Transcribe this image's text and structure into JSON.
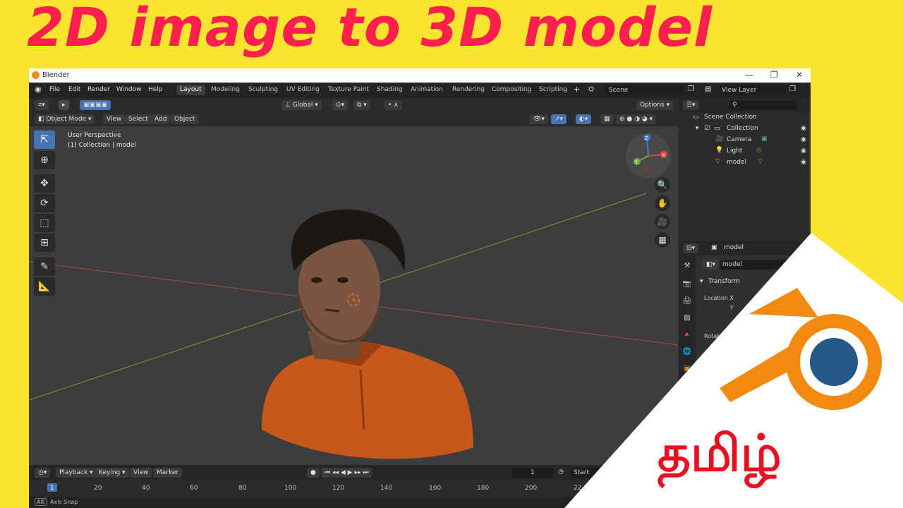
{
  "thumbnail": {
    "headline": "2D image to 3D model",
    "language_label": "தமிழ்",
    "accent": "#ff1f4f",
    "background": "#f9e52f"
  },
  "window": {
    "title": "Blender",
    "controls": [
      "—",
      "❐",
      "✕"
    ]
  },
  "menu": {
    "items": [
      "File",
      "Edit",
      "Render",
      "Window",
      "Help"
    ],
    "workspaces": [
      "Layout",
      "Modeling",
      "Sculpting",
      "UV Editing",
      "Texture Paint",
      "Shading",
      "Animation",
      "Rendering",
      "Compositing",
      "Scripting"
    ],
    "active_workspace": "Layout",
    "scene": "Scene",
    "view_layer": "View Layer"
  },
  "viewport_header": {
    "orientation": "Global",
    "options": "Options",
    "mode": "Object Mode",
    "menus": [
      "View",
      "Select",
      "Add",
      "Object"
    ]
  },
  "viewport": {
    "perspective": "User Perspective",
    "collection_info": "(1) Collection | model",
    "gizmo_axes": [
      "X",
      "Y",
      "Z"
    ]
  },
  "outliner": {
    "root": "Scene Collection",
    "collection": "Collection",
    "items": [
      "Camera",
      "Light",
      "model"
    ]
  },
  "properties": {
    "object_name": "model",
    "data_name": "model",
    "panel": "Transform",
    "location_label": "Location X",
    "y_label": "Y",
    "rotation_label": "Rotat"
  },
  "timeline": {
    "menus": [
      "Playback",
      "Keying",
      "View",
      "Marker"
    ],
    "current_frame": "1",
    "start_label": "Start",
    "ticks": [
      "1",
      "20",
      "40",
      "60",
      "80",
      "100",
      "120",
      "140",
      "160",
      "180",
      "200",
      "22"
    ]
  },
  "status": {
    "key": "Alt",
    "text": "Axis Snap"
  }
}
